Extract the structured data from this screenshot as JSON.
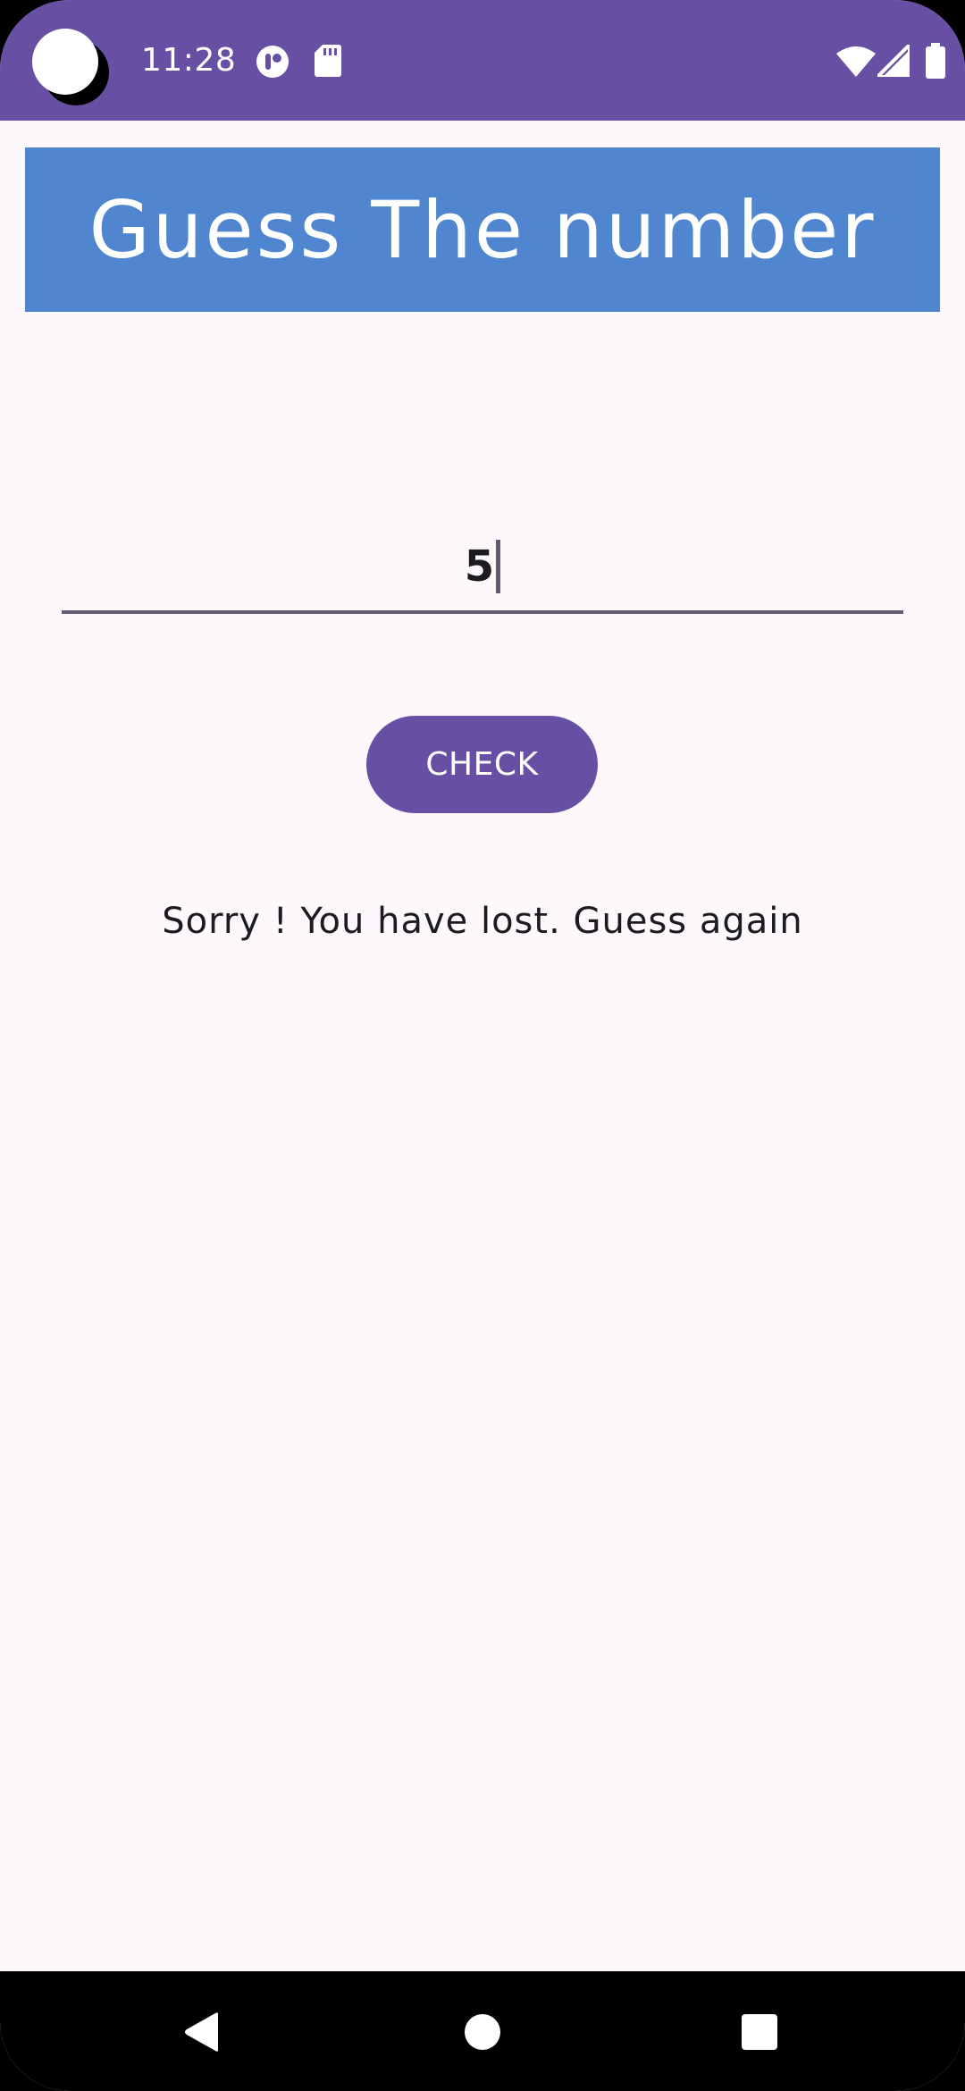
{
  "status_bar": {
    "time": "11:28",
    "icons": [
      "camera-dot",
      "notification-icon",
      "sd-card-icon",
      "wifi-icon",
      "signal-icon",
      "battery-icon"
    ]
  },
  "app": {
    "title": "Guess The number",
    "guess_input": {
      "value": "5",
      "type": "number"
    },
    "check_button_label": "CHECK",
    "result_message": "Sorry ! You have lost. Guess again"
  },
  "nav_bar": {
    "buttons": [
      "back-icon",
      "home-icon",
      "recents-icon"
    ]
  },
  "colors": {
    "status_bar": "#6750a4",
    "title_banner": "#5086cf",
    "button": "#6750a4",
    "background": "#fdf8fc",
    "underline": "#625b71",
    "text": "#1c1b1f"
  }
}
